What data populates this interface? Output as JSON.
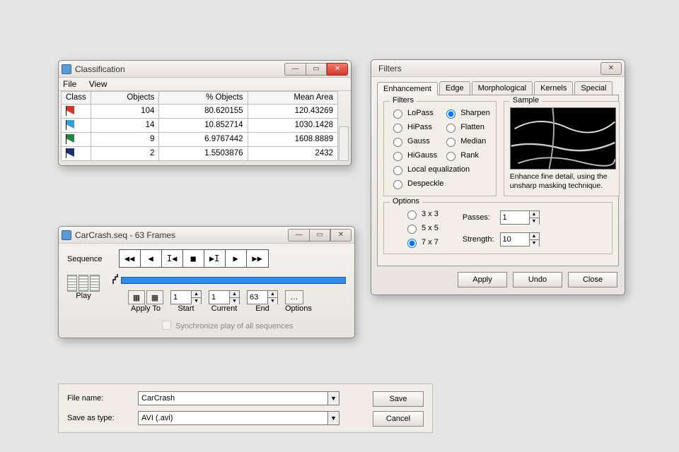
{
  "classification": {
    "title": "Classification",
    "menus": {
      "file": "File",
      "view": "View"
    },
    "headers": {
      "class": "Class",
      "objects": "Objects",
      "pctObjects": "% Objects",
      "meanArea": "Mean Area"
    },
    "rows": [
      {
        "color": "#d63426",
        "objects": "104",
        "pct": "80.620155",
        "mean": "120.43269"
      },
      {
        "color": "#2fa0d6",
        "objects": "14",
        "pct": "10.852714",
        "mean": "1030.1428"
      },
      {
        "color": "#1f8a3d",
        "objects": "9",
        "pct": "6.9767442",
        "mean": "1608.8889"
      },
      {
        "color": "#1b2f7a",
        "objects": "2",
        "pct": "1.5503876",
        "mean": "2432"
      }
    ]
  },
  "sequence": {
    "title": "CarCrash.seq - 63 Frames",
    "label": "Sequence",
    "play": "Play",
    "applyTo": "Apply To",
    "start": {
      "label": "Start",
      "value": "1"
    },
    "current": {
      "label": "Current",
      "value": "1"
    },
    "end": {
      "label": "End",
      "value": "63"
    },
    "options": "Options",
    "sync": "Synchronize play of all sequences"
  },
  "filters": {
    "title": "Filters",
    "tabs": {
      "enhancement": "Enhancement",
      "edge": "Edge",
      "morph": "Morphological",
      "kernels": "Kernels",
      "special": "Special"
    },
    "group_filters": "Filters",
    "group_sample": "Sample",
    "group_options": "Options",
    "radios": {
      "lopass": "LoPass",
      "sharpen": "Sharpen",
      "hipass": "HiPass",
      "flatten": "Flatten",
      "gauss": "Gauss",
      "median": "Median",
      "higauss": "HiGauss",
      "rank": "Rank",
      "localeq": "Local equalization",
      "despeckle": "Despeckle"
    },
    "selected_filter": "sharpen",
    "sample_desc": "Enhance fine detail, using the unsharp masking technique.",
    "kernel": {
      "k3": "3 x 3",
      "k5": "5 x 5",
      "k7": "7 x 7"
    },
    "selected_kernel": "k7",
    "passes": {
      "label": "Passes:",
      "value": "1"
    },
    "strength": {
      "label": "Strength:",
      "value": "10"
    },
    "buttons": {
      "apply": "Apply",
      "undo": "Undo",
      "close": "Close"
    }
  },
  "save": {
    "filename_label": "File name:",
    "filename": "CarCrash",
    "type_label": "Save as type:",
    "type": "AVI (.avi)",
    "save": "Save",
    "cancel": "Cancel"
  }
}
